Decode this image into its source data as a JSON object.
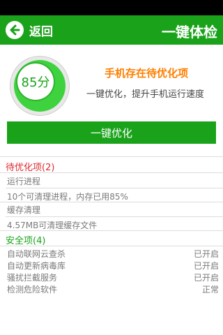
{
  "header": {
    "back_label": "返回",
    "title": "一键体检"
  },
  "summary": {
    "score": "85分",
    "score_value": 85,
    "title": "手机存在待优化项",
    "description": "一键优化，提升手机运行速度"
  },
  "optimize_button": "一键优化",
  "pending": {
    "header": "待优化项(2)",
    "items": [
      {
        "title": "运行进程",
        "detail": "10个可清理进程，内存已用85%"
      },
      {
        "title": "缓存清理",
        "detail": "4.57MB可清理缓存文件"
      }
    ]
  },
  "security": {
    "header": "安全项(4)",
    "items": [
      {
        "label": "自动联网云查杀",
        "status": "已开启"
      },
      {
        "label": "自动更新病毒库",
        "status": "已开启"
      },
      {
        "label": "骚扰拦截服务",
        "status": "已开启"
      },
      {
        "label": "检测危险软件",
        "status": "正常"
      }
    ]
  },
  "colors": {
    "accent": "#1aa31a",
    "warning": "#ff7f00",
    "alert": "#e0282e"
  },
  "icons": {
    "back": "back-arrow-icon"
  }
}
